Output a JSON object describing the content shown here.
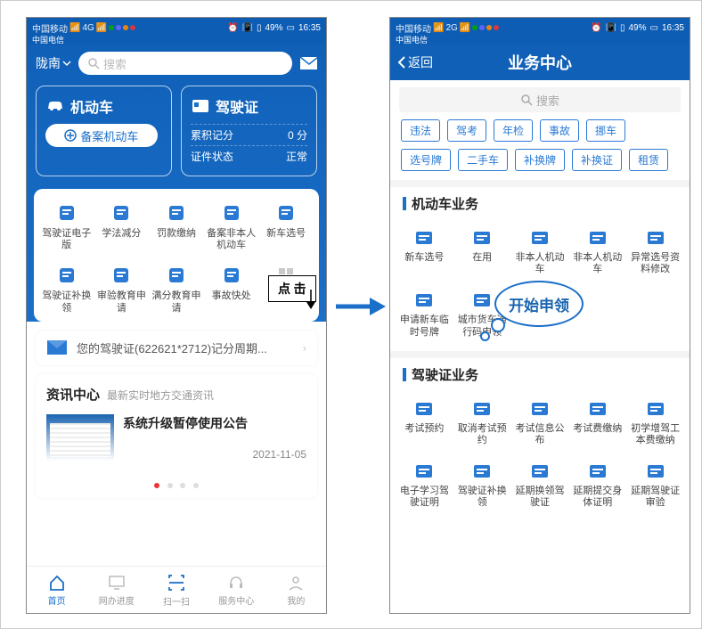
{
  "status_bar": {
    "carrier1": "中国移动",
    "carrier2": "中国电信",
    "net": "4G",
    "battery": "49%",
    "time": "16:35",
    "alarm": "⏰",
    "vib": "📳",
    "batt_icon": "🔋"
  },
  "left": {
    "location": "陇南",
    "search_placeholder": "搜索",
    "vehicle_title": "机动车",
    "register_btn": "备案机动车",
    "license_title": "驾驶证",
    "score_label": "累积记分",
    "score_value": "0 分",
    "doc_label": "证件状态",
    "doc_value": "正常",
    "grid_row1": [
      {
        "n": "license-e-icon",
        "l": "驾驶证电子版"
      },
      {
        "n": "law-deduct-icon",
        "l": "学法减分"
      },
      {
        "n": "fine-pay-icon",
        "l": "罚款缴纳"
      },
      {
        "n": "record-other-icon",
        "l": "备案非本人机动车"
      },
      {
        "n": "newcar-num-icon",
        "l": "新车选号"
      }
    ],
    "grid_row2": [
      {
        "n": "license-renew-icon",
        "l": "驾驶证补换领"
      },
      {
        "n": "exam-edu-icon",
        "l": "审验教育申请"
      },
      {
        "n": "fullscore-edu-icon",
        "l": "满分教育申请"
      },
      {
        "n": "accident-fast-icon",
        "l": "事故快处"
      },
      {
        "n": "more-icon",
        "l": "更多"
      }
    ],
    "notice": "您的驾驶证(622621*2712)记分周期...",
    "news_header": "资讯中心",
    "news_sub": "最新实时地方交通资讯",
    "news_title": "系统升级暂停使用公告",
    "news_date": "2021-11-05",
    "tabs": [
      "首页",
      "网办进度",
      "扫一扫",
      "服务中心",
      "我的"
    ]
  },
  "right": {
    "back": "返回",
    "title": "业务中心",
    "search_placeholder": "搜索",
    "chips": [
      "违法",
      "驾考",
      "年检",
      "事故",
      "挪车",
      "选号牌",
      "二手车",
      "补换牌",
      "补换证",
      "租赁"
    ],
    "sec_vehicle": "机动车业务",
    "vehicle_services": [
      {
        "n": "newcar-icon",
        "l": "新车选号"
      },
      {
        "n": "inuse-icon",
        "l": "在用"
      },
      {
        "n": "temp-icon",
        "l": "非本人机动车"
      },
      {
        "n": "backup-icon",
        "l": "非本人机动车"
      },
      {
        "n": "abnormal-icon",
        "l": "异常选号资料修改"
      },
      {
        "n": "apply-temp-icon",
        "l": "申请新车临时号牌"
      },
      {
        "n": "truck-pass-icon",
        "l": "城市货车通行码申领"
      }
    ],
    "sec_license": "驾驶证业务",
    "license_services": [
      {
        "n": "exam-book-icon",
        "l": "考试预约"
      },
      {
        "n": "exam-cancel-icon",
        "l": "取消考试预约"
      },
      {
        "n": "exam-info-icon",
        "l": "考试信息公布"
      },
      {
        "n": "exam-fee-icon",
        "l": "考试费缴纳"
      },
      {
        "n": "first-add-icon",
        "l": "初学增驾工本费缴纳"
      },
      {
        "n": "estudy-icon",
        "l": "电子学习驾驶证明"
      },
      {
        "n": "lic-renew2-icon",
        "l": "驾驶证补换领"
      },
      {
        "n": "ext-renew-icon",
        "l": "延期换领驾驶证"
      },
      {
        "n": "ext-body-icon",
        "l": "延期提交身体证明"
      },
      {
        "n": "ext-check-icon",
        "l": "延期驾驶证审验"
      }
    ]
  },
  "annotations": {
    "click_label": "点 击",
    "bubble": "开始申领"
  },
  "colors": {
    "primary": "#1a6fc9",
    "deep": "#0e5db5"
  }
}
